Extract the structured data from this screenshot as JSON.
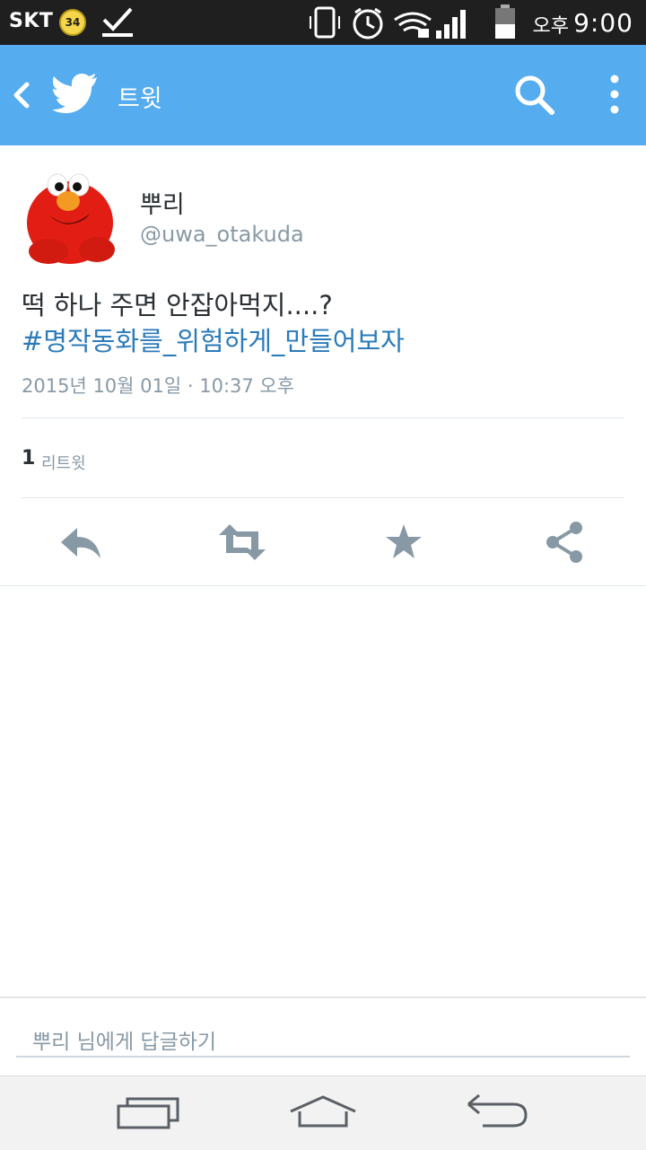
{
  "status_bar": {
    "carrier": "SKT",
    "badge_count": "34",
    "ampm": "오후",
    "time": "9:00",
    "icons": [
      "notification-badge-icon",
      "download-check-icon",
      "vibrate-icon",
      "alarm-icon",
      "wifi-lock-icon",
      "signal-icon",
      "battery-icon"
    ]
  },
  "app_bar": {
    "title": "트윗",
    "icons": [
      "back-icon",
      "twitter-bird-icon",
      "search-icon",
      "more-vert-icon"
    ],
    "color": "#55acee"
  },
  "tweet": {
    "user_name": "뿌리",
    "handle": "@uwa_otakuda",
    "text": "떡 하나 주면 안잡아먹지....?",
    "hashtag": "#명작동화를_위험하게_만들어보자",
    "timestamp": "2015년 10월 01일 · 10:37 오후",
    "retweet_count": "1",
    "retweet_label": "리트윗"
  },
  "actions": [
    "reply-icon",
    "retweet-icon",
    "favorite-icon",
    "share-icon"
  ],
  "reply_box": {
    "placeholder": "뿌리 님에게 답글하기"
  },
  "nav_bar": [
    "recent-apps-icon",
    "home-icon",
    "back-nav-icon"
  ],
  "colors": {
    "accent": "#55acee",
    "hashtag": "#2b7bb9",
    "secondary_text": "#8899a6",
    "action_icon": "#8899a6"
  }
}
